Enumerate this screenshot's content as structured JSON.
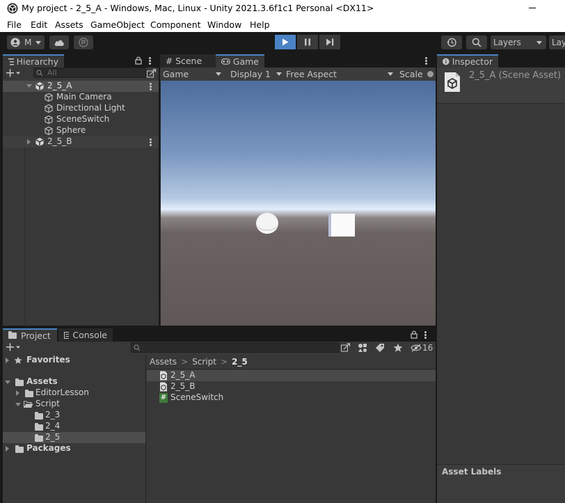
{
  "window": {
    "title": "My project - 2_5_A - Windows, Mac, Linux - Unity 2021.3.6f1c1 Personal <DX11>"
  },
  "menu": [
    "File",
    "Edit",
    "Assets",
    "GameObject",
    "Component",
    "Window",
    "Help"
  ],
  "toolbar": {
    "account_label": "M",
    "layers_label": "Layers",
    "layout_label": "Lay"
  },
  "hierarchy": {
    "tab_label": "Hierarchy",
    "search_placeholder": "All",
    "scenes": [
      {
        "name": "2_5_A",
        "expanded": true,
        "children": [
          "Main Camera",
          "Directional Light",
          "SceneSwitch",
          "Sphere"
        ]
      },
      {
        "name": "2_5_B",
        "expanded": false,
        "children": []
      }
    ]
  },
  "view": {
    "tabs": [
      {
        "label": "Scene",
        "icon": "grid-icon"
      },
      {
        "label": "Game",
        "icon": "gamepad-icon",
        "active": true
      }
    ],
    "game_dropdown": "Game",
    "display_dropdown": "Display 1",
    "aspect_dropdown": "Free Aspect",
    "scale_label": "Scale"
  },
  "inspector": {
    "tab_label": "Inspector",
    "asset_title": "2_5_A (Scene Asset)",
    "asset_labels_header": "Asset Labels"
  },
  "project": {
    "tabs": [
      {
        "label": "Project",
        "icon": "folder-icon",
        "active": true
      },
      {
        "label": "Console",
        "icon": "console-icon"
      }
    ],
    "hidden_count": "16",
    "tree": {
      "favorites_label": "Favorites",
      "assets_label": "Assets",
      "editor_lesson_label": "EditorLesson",
      "script_label": "Script",
      "script_children": [
        "2_3",
        "2_4",
        "2_5"
      ],
      "packages_label": "Packages"
    },
    "breadcrumb": [
      "Assets",
      "Script",
      "2_5"
    ],
    "files": [
      {
        "name": "2_5_A",
        "icon": "unity-scene-icon"
      },
      {
        "name": "2_5_B",
        "icon": "unity-scene-icon"
      },
      {
        "name": "SceneSwitch",
        "icon": "csharp-script-icon"
      }
    ]
  },
  "colors": {
    "accent": "#4a84c6",
    "panel": "#383838",
    "selection": "#4d4d4d",
    "sky_top": "#4d6c9c",
    "horizon": "#e3eefc",
    "ground": "#6b6361"
  }
}
